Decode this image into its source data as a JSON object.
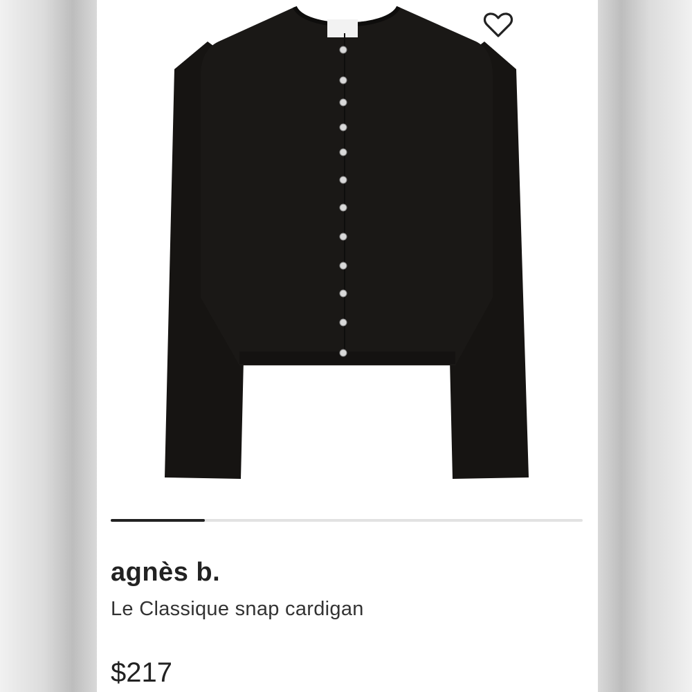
{
  "product": {
    "brand": "agnès b.",
    "name": "Le Classique snap cardigan",
    "price": "$217"
  },
  "carousel": {
    "progress": 0.2
  },
  "icons": {
    "favorite": "heart-outline-icon"
  },
  "colors": {
    "garment": "#161412",
    "snaps": "#d9d9d9",
    "text": "#222222"
  }
}
